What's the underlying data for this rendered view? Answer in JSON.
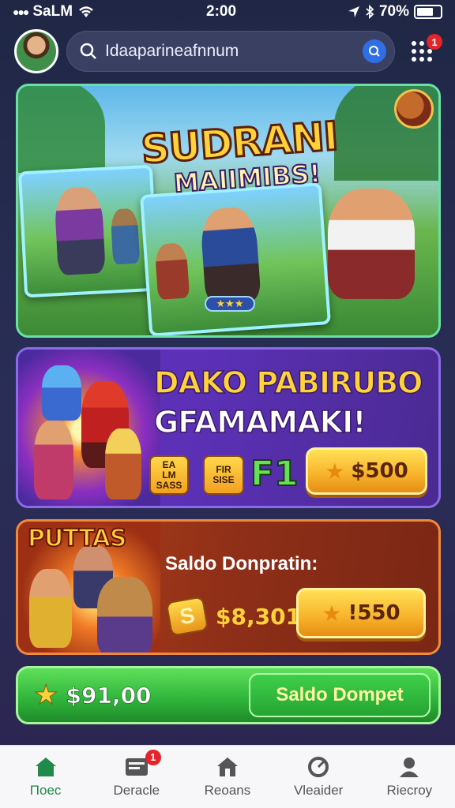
{
  "status_bar": {
    "carrier": "SaLM",
    "time": "2:00",
    "battery": "70%",
    "battery_level": 0.7
  },
  "header": {
    "avatar": "player-avatar",
    "search_text": "Idaaparineafnnum",
    "notification_count": "1"
  },
  "hero": {
    "title": "SUDRANI",
    "subtitle": "MAIIMIBS!"
  },
  "promo": {
    "title": "DAKO PABIRUBO",
    "subtitle": "GFAMAMAKI!",
    "tiles": [
      {
        "top": "EA",
        "mid": "LM",
        "bottom": "SASS"
      },
      {
        "top": "FIR",
        "mid": "",
        "bottom": "SISE"
      }
    ],
    "green_tile": "F1",
    "price_button": "$500"
  },
  "saldo_card": {
    "tag": "PUTTAS",
    "label": "Saldo Donpratin:",
    "coin_symbol": "S",
    "amount": "$8,301",
    "button": "!550"
  },
  "green_bar": {
    "amount": "$91,00",
    "button": "Saldo Dompet"
  },
  "bottom_nav": {
    "items": [
      {
        "label": "Поес",
        "icon": "home-icon",
        "active": true
      },
      {
        "label": "Deracle",
        "icon": "inbox-icon",
        "badge": "1"
      },
      {
        "label": "Reoans",
        "icon": "house-icon"
      },
      {
        "label": "Vleaider",
        "icon": "dial-icon"
      },
      {
        "label": "Riecroy",
        "icon": "profile-icon"
      }
    ]
  },
  "colors": {
    "accent_green": "#2eb33a",
    "accent_gold": "#f7b22a",
    "badge_red": "#e3242b",
    "purple": "#5a2fb5",
    "orange": "#b0421a"
  }
}
